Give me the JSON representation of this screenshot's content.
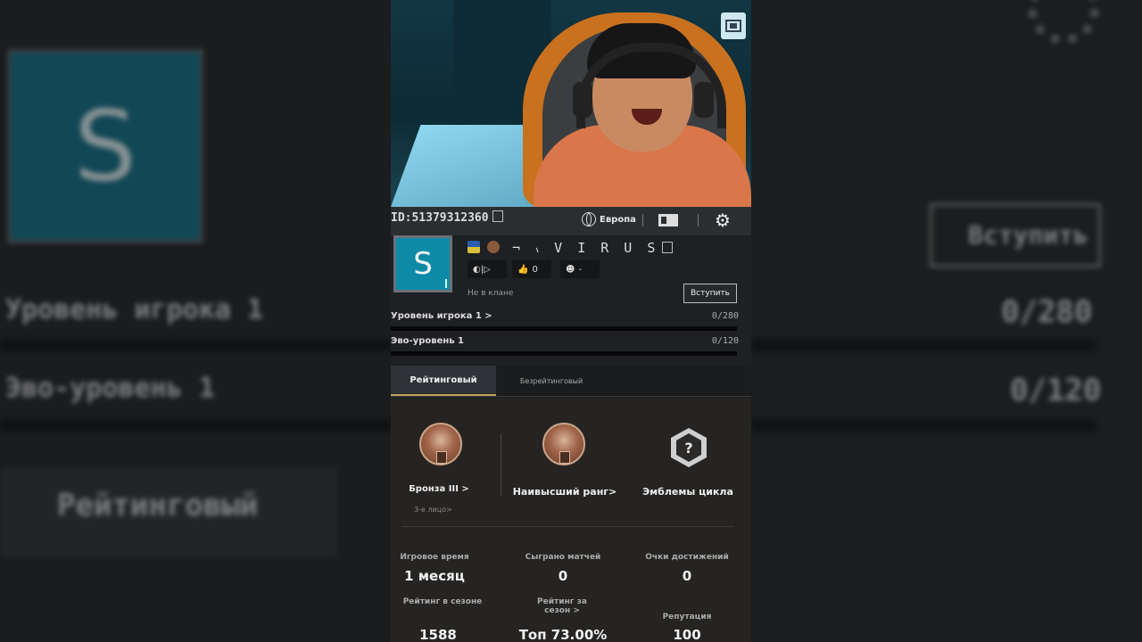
{
  "bg_left": {
    "avatar_letter": "S",
    "player_level": "Уровень игрока 1",
    "evo_level": "Эво-уровень 1",
    "ranked_tab": "Рейтинговый"
  },
  "bg_right": {
    "join_label": "Вступить",
    "player_level_value": "0/280",
    "evo_level_value": "0/120"
  },
  "header": {
    "player_id": "ID:51379312360",
    "region": "Европа"
  },
  "profile": {
    "avatar_letter": "S",
    "nickname": "¬ ៶ V I R U S",
    "likes": "0",
    "mood": "-",
    "clan_status": "Не в клане",
    "join_label": "Вступить"
  },
  "levels": {
    "player_level_label": "Уровень игрока 1  >",
    "player_level_value": "0/280",
    "evo_level_label": "Эво-уровень 1",
    "evo_level_value": "0/120"
  },
  "tabs": [
    "Рейтинговый",
    "Безрейтинговый"
  ],
  "ranks": {
    "current_rank": "Бронза III  >",
    "current_rank_sub": "3-е лицо>",
    "highest_rank": "Наивысший ранг>",
    "season_emblems": "Эмблемы цикла"
  },
  "stats": [
    {
      "label": "Игровое время",
      "value": "1 месяц"
    },
    {
      "label": "Сыграно матчей",
      "value": "0"
    },
    {
      "label": "Очки достижений",
      "value": "0"
    },
    {
      "label": "Рейтинг в сезоне",
      "value": "1588"
    },
    {
      "label": "Рейтинг за сезон >",
      "value": "Топ 73.00%"
    },
    {
      "label": "Репутация",
      "value": "100"
    }
  ],
  "colors": {
    "accent_gold": "#bca25a",
    "avatar_teal": "#0e8aa6",
    "bronze": "#a0644a"
  }
}
